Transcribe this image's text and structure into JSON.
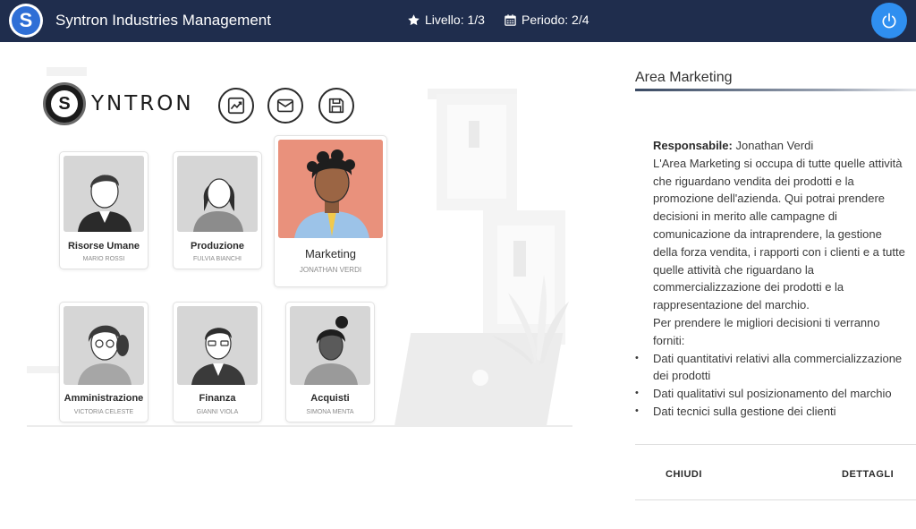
{
  "header": {
    "title": "Syntron Industries Management",
    "logo_letter": "S",
    "level": "Livello: 1/3",
    "period": "Periodo: 2/4"
  },
  "brand": {
    "logo_letter": "S",
    "logo_text": "YNTRON"
  },
  "departments": [
    {
      "name": "Risorse Umane",
      "person": "MARIO ROSSI",
      "active": false
    },
    {
      "name": "Produzione",
      "person": "FULVIA BIANCHI",
      "active": false
    },
    {
      "name": "Marketing",
      "person": "JONATHAN VERDI",
      "active": true
    },
    {
      "name": "Amministrazione",
      "person": "VICTORIA CELESTE",
      "active": false
    },
    {
      "name": "Finanza",
      "person": "GIANNI VIOLA",
      "active": false
    },
    {
      "name": "Acquisti",
      "person": "SIMONA MENTA",
      "active": false
    }
  ],
  "panel": {
    "title": "Area Marketing",
    "responsible_label": "Responsabile:",
    "responsible_name": "Jonathan Verdi",
    "description": "L'Area Marketing si occupa di tutte quelle attività che riguardano vendita dei prodotti e la promozione dell'azienda. Qui potrai prendere decisioni in merito alle campagne di comunicazione da intraprendere, la gestione della forza vendita, i rapporti con i clienti e a tutte quelle attività che riguardano la commercializzazione dei prodotti e la rappresentazione del marchio.",
    "intro_list": "Per prendere le migliori decisioni ti verranno forniti:",
    "list": [
      "Dati quantitativi relativi alla commercializzazione dei prodotti",
      "Dati qualitativi sul posizionamento del marchio",
      "Dati tecnici sulla gestione dei clienti"
    ],
    "close_label": "CHIUDI",
    "details_label": "DETTAGLI"
  },
  "colors": {
    "header_bg": "#1f2d4d",
    "accent_blue": "#2f8ff0",
    "active_card_bg": "#e9917c"
  }
}
